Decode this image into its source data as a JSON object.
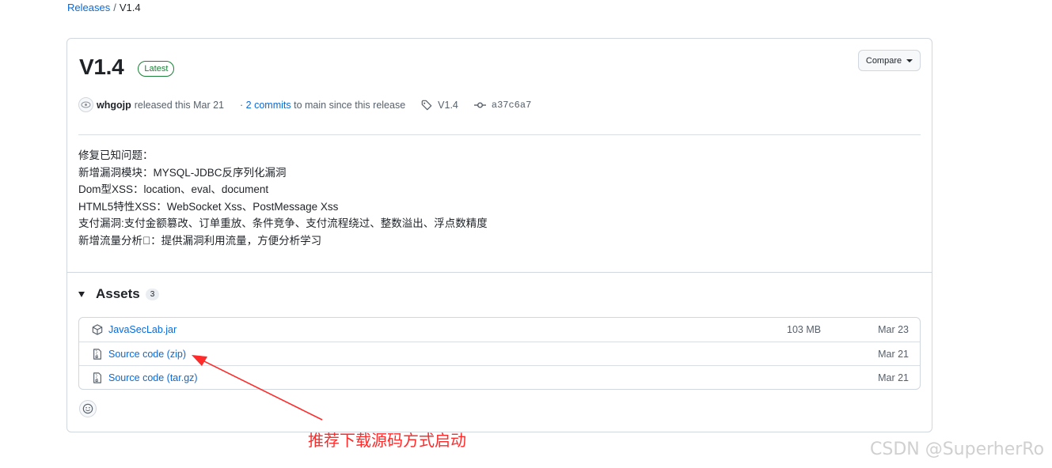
{
  "breadcrumb": {
    "releases": "Releases",
    "separator": "/",
    "current": "V1.4"
  },
  "release": {
    "title": "V1.4",
    "badge": "Latest",
    "compare_label": "Compare",
    "author": "whgojp",
    "released_text": "released this Mar 21",
    "commits_prefix": "·",
    "commits_link": "2 commits",
    "commits_suffix": "to main since this release",
    "tag": "V1.4",
    "sha": "a37c6a7"
  },
  "notes": [
    "修复已知问题：",
    "新增漏洞模块：MYSQL-JDBC反序列化漏洞",
    "Dom型XSS：location、eval、document",
    "HTML5特性XSS：WebSocket Xss、PostMessage Xss",
    "支付漏洞:支付金额篡改、订单重放、条件竞争、支付流程绕过、整数溢出、浮点数精度",
    "新增流量分析\u0000：提供漏洞利用流量，方便分析学习"
  ],
  "assets": {
    "title": "Assets",
    "count": "3",
    "items": [
      {
        "name": "JavaSecLab.jar",
        "suffix": "",
        "size": "103 MB",
        "date": "Mar 23",
        "icon": "package-icon"
      },
      {
        "name": "Source code",
        "suffix": "(zip)",
        "size": "",
        "date": "Mar 21",
        "icon": "file-zip-icon"
      },
      {
        "name": "Source code",
        "suffix": "(tar.gz)",
        "size": "",
        "date": "Mar 21",
        "icon": "file-zip-icon"
      }
    ]
  },
  "annotation": {
    "text": "推荐下载源码方式启动",
    "color": "#ff2b2b"
  },
  "watermark": "CSDN @SuperherRo"
}
